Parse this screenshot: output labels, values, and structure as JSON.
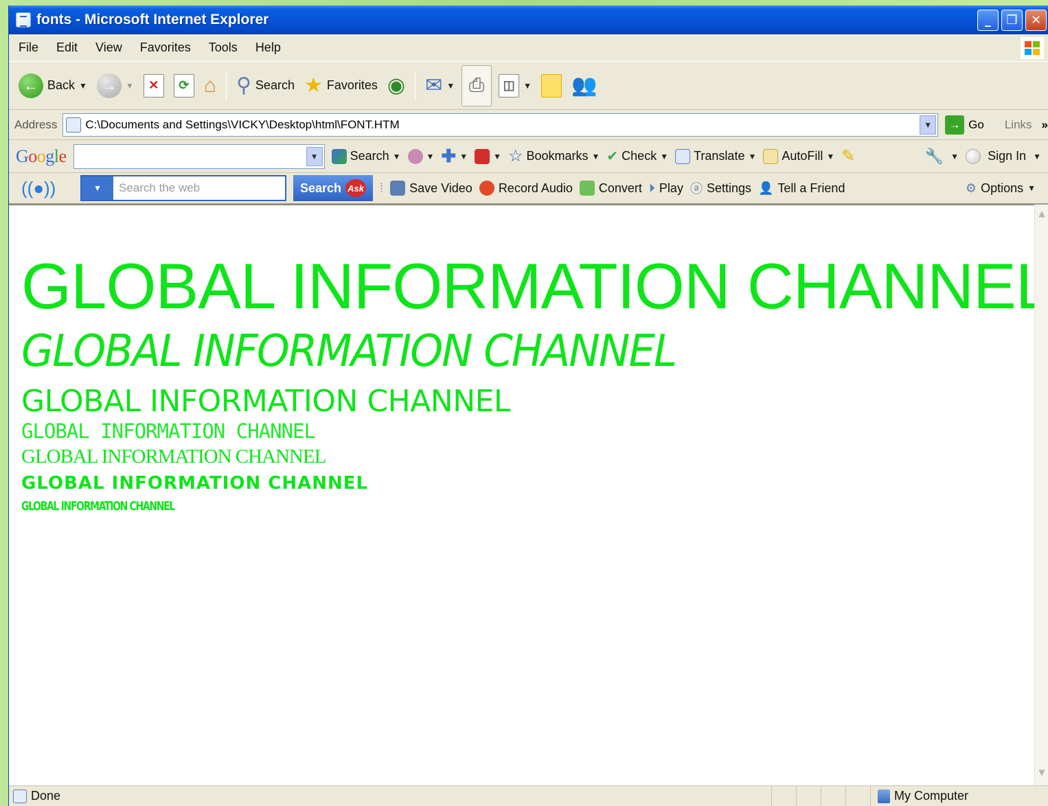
{
  "window": {
    "title": "fonts - Microsoft Internet Explorer",
    "min_label": "_",
    "max_label": "❐",
    "close_label": "✕"
  },
  "menu": [
    "File",
    "Edit",
    "View",
    "Favorites",
    "Tools",
    "Help"
  ],
  "toolbar": {
    "back_label": "Back",
    "search_label": "Search",
    "favorites_label": "Favorites"
  },
  "address": {
    "label": "Address",
    "value": "C:\\Documents and Settings\\VICKY\\Desktop\\html\\FONT.HTM",
    "go_label": "Go",
    "links_label": "Links",
    "more": "»"
  },
  "google_toolbar": {
    "search_label": "Search",
    "bookmarks_label": "Bookmarks",
    "check_label": "Check",
    "translate_label": "Translate",
    "autofill_label": "AutoFill",
    "signin_label": "Sign In"
  },
  "ask_toolbar": {
    "placeholder": "Search the web",
    "search_button": "Search",
    "ask_logo": "Ask",
    "save_video": "Save Video",
    "record_audio": "Record Audio",
    "convert": "Convert",
    "play": "Play",
    "settings": "Settings",
    "tell_friend": "Tell a Friend",
    "options": "Options"
  },
  "content": {
    "lines": [
      "GLOBAL INFORMATION CHANNEL",
      "GLOBAL INFORMATION CHANNEL",
      "GLOBAL INFORMATION CHANNEL",
      "GLOBAL  INFORMATION  CHANNEL",
      "GLOBAL INFORMATION CHANNEL",
      "GLOBAL INFORMATION CHANNEL",
      "GLOBAL INFORMATION CHANNEL"
    ],
    "text_color": "#0fe41a"
  },
  "status": {
    "left": "Done",
    "zone": "My Computer"
  }
}
